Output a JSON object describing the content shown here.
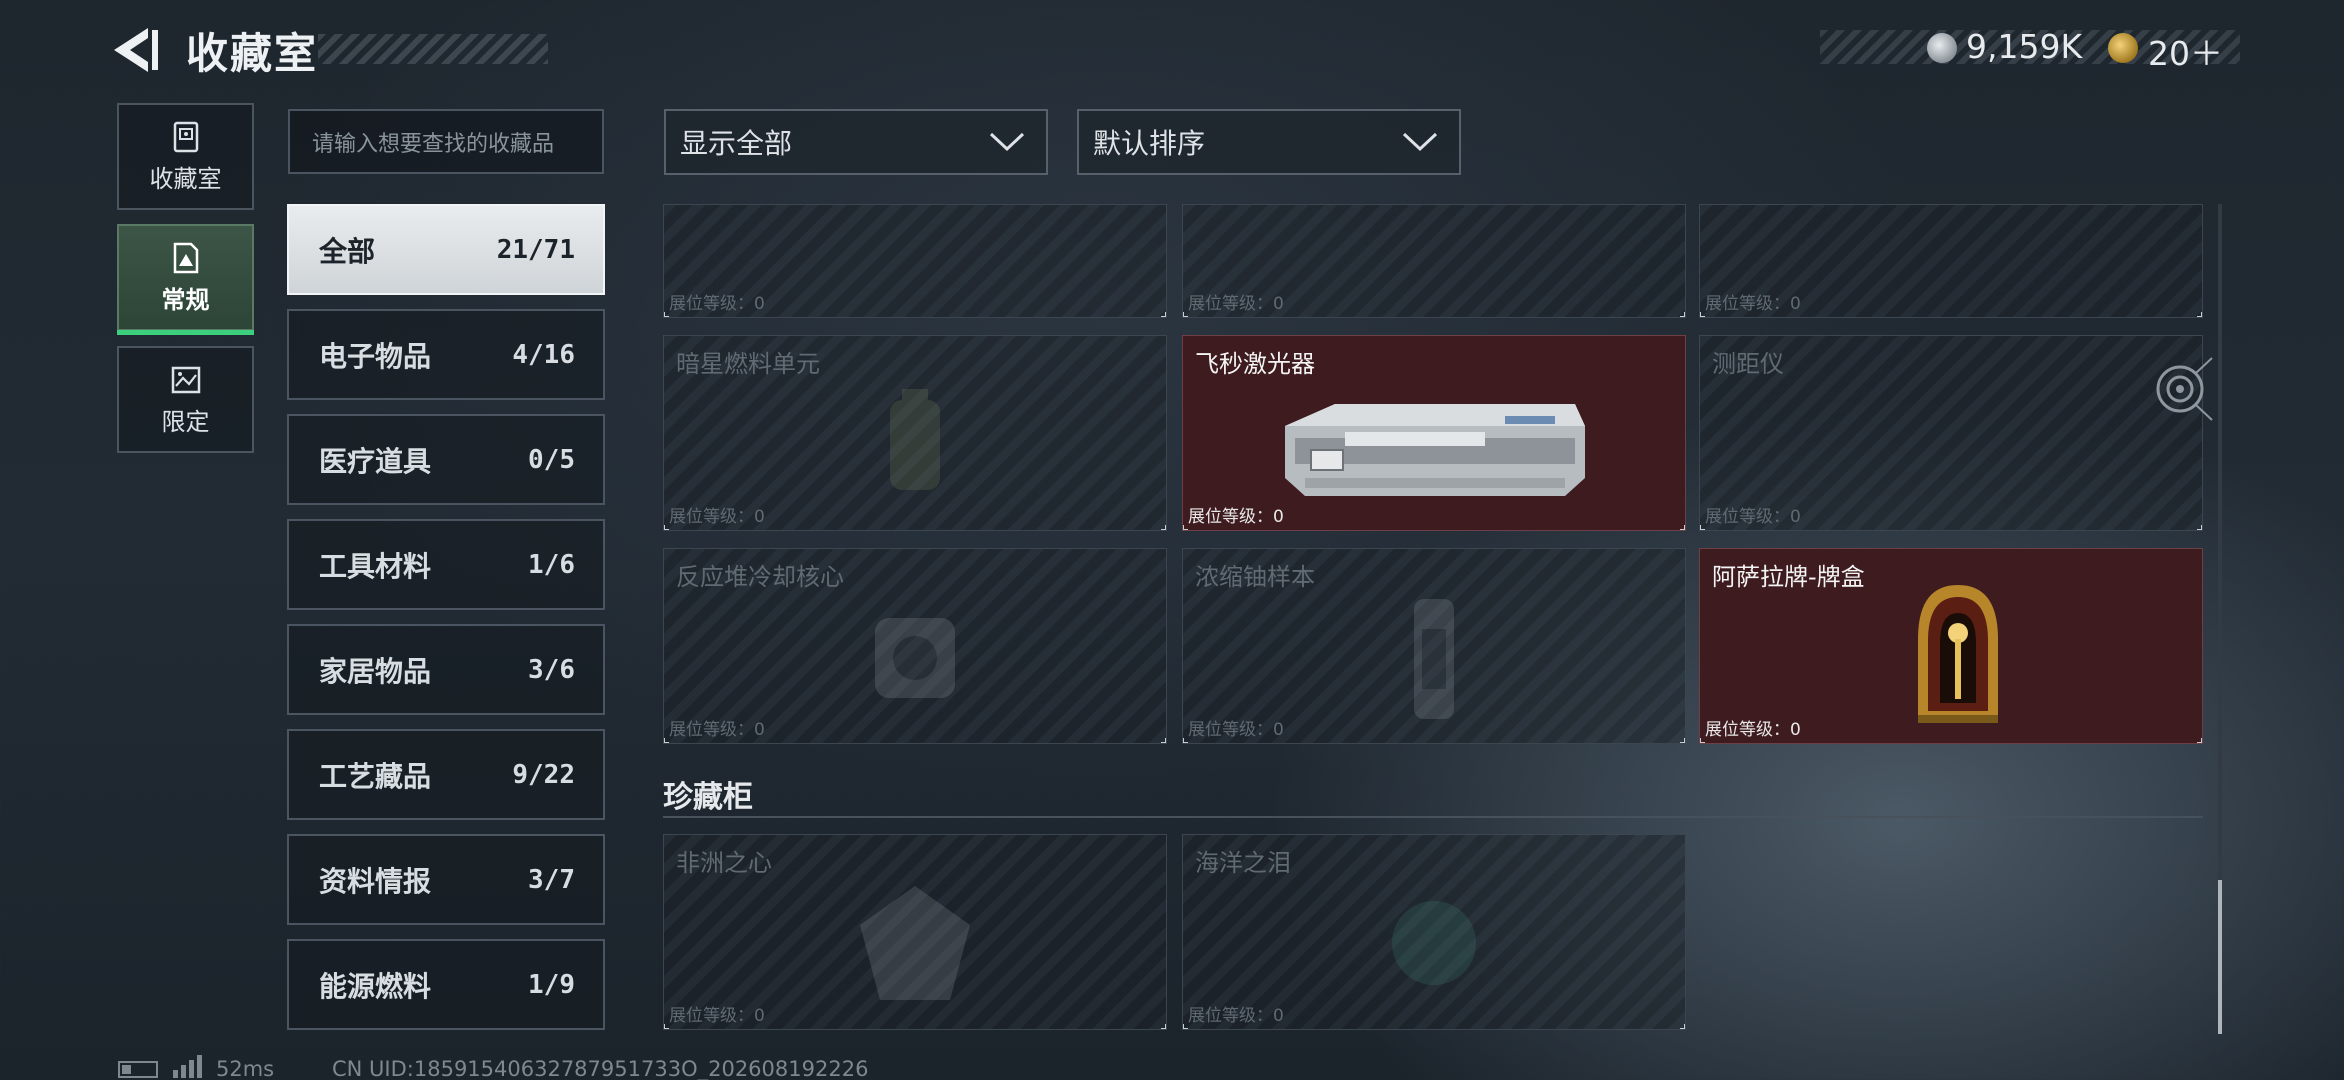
{
  "header": {
    "title": "收藏室",
    "currency": [
      {
        "icon": "silver-coin-icon",
        "value": "9,159K"
      },
      {
        "icon": "gold-coin-icon",
        "value": "20＋"
      }
    ]
  },
  "rail": [
    {
      "label": "收藏室",
      "icon": "vault-icon",
      "active": false
    },
    {
      "label": "常规",
      "icon": "document-icon",
      "active": true
    },
    {
      "label": "限定",
      "icon": "image-icon",
      "active": false
    }
  ],
  "search": {
    "placeholder": "请输入想要查找的收藏品"
  },
  "categories": [
    {
      "name": "全部",
      "count": "21/71",
      "active": true
    },
    {
      "name": "电子物品",
      "count": "4/16"
    },
    {
      "name": "医疗道具",
      "count": "0/5"
    },
    {
      "name": "工具材料",
      "count": "1/6"
    },
    {
      "name": "家居物品",
      "count": "3/6"
    },
    {
      "name": "工艺藏品",
      "count": "9/22"
    },
    {
      "name": "资料情报",
      "count": "3/7"
    },
    {
      "name": "能源燃料",
      "count": "1/9"
    }
  ],
  "filters": {
    "show": "显示全部",
    "sort": "默认排序"
  },
  "level_label": "展位等级：0",
  "items": [
    {
      "name": "",
      "owned": false
    },
    {
      "name": "",
      "owned": false
    },
    {
      "name": "",
      "owned": false
    },
    {
      "name": "暗星燃料单元",
      "owned": false
    },
    {
      "name": "飞秒激光器",
      "owned": true
    },
    {
      "name": "测距仪",
      "owned": false
    },
    {
      "name": "反应堆冷却核心",
      "owned": false
    },
    {
      "name": "浓缩铀样本",
      "owned": false
    },
    {
      "name": "阿萨拉牌-牌盒",
      "owned": true
    }
  ],
  "section": {
    "title": "珍藏柜",
    "items": [
      {
        "name": "非洲之心",
        "owned": false
      },
      {
        "name": "海洋之泪",
        "owned": false
      }
    ]
  },
  "footer": {
    "ping": "52ms",
    "uid": "CN UID:18591540632787951733O_202608192226"
  },
  "colors": {
    "accent": "#3ccf7e",
    "owned_bg": "#3e1b1f"
  }
}
